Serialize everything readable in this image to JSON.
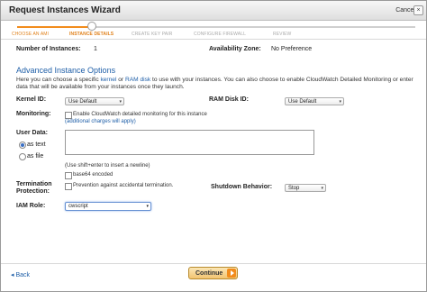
{
  "window": {
    "title": "Request Instances Wizard",
    "cancel_label": "Cancel"
  },
  "steps": [
    {
      "label": "CHOOSE AN AMI",
      "state": "done"
    },
    {
      "label": "INSTANCE DETAILS",
      "state": "current"
    },
    {
      "label": "CREATE KEY PAIR",
      "state": "todo"
    },
    {
      "label": "CONFIGURE FIREWALL",
      "state": "todo"
    },
    {
      "label": "REVIEW",
      "state": "todo"
    }
  ],
  "summary": {
    "instances_label": "Number of Instances:",
    "instances_value": "1",
    "zone_label": "Availability Zone:",
    "zone_value": "No Preference"
  },
  "advanced": {
    "title": "Advanced Instance Options",
    "desc_prefix": "Here you can choose a specific ",
    "desc_kernel_link": "kernel",
    "desc_or": " or ",
    "desc_ram_link": "RAM disk",
    "desc_rest": " to use with your instances. You can also choose to enable CloudWatch Detailed Monitoring or enter data that will be available from your instances once they launch.",
    "kernel_label": "Kernel ID:",
    "kernel_value": "Use Default",
    "ramdisk_label": "RAM Disk ID:",
    "ramdisk_value": "Use Default",
    "monitoring_label": "Monitoring:",
    "monitoring_text": "Enable CloudWatch detailed monitoring for this instance",
    "monitoring_note": "(additional charges will apply)",
    "userdata_label": "User Data:",
    "as_text": "as text",
    "as_file": "as file",
    "userdata_hint": "(Use shift+enter to insert a newline)",
    "base64": "base64 encoded",
    "termination_label_1": "Termination",
    "termination_label_2": "Protection:",
    "termination_text": "Prevention against accidental termination.",
    "shutdown_label": "Shutdown Behavior:",
    "shutdown_value": "Stop",
    "iam_label": "IAM Role:",
    "iam_value": "cwscript"
  },
  "footer": {
    "back": "Back",
    "continue": "Continue"
  },
  "colors": {
    "accent": "#f28c1c",
    "link": "#1f5fa8",
    "step_done": "#f28c1c",
    "step_todo": "#bdbdbd"
  }
}
